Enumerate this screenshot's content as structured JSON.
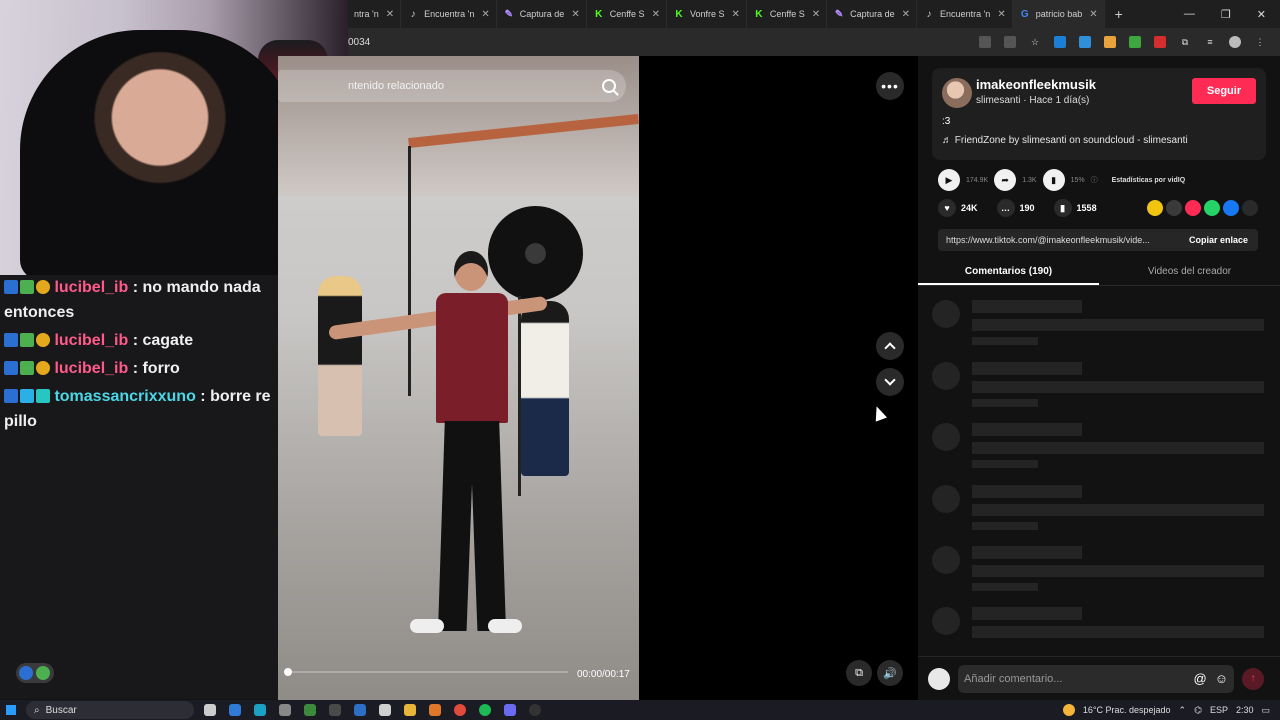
{
  "browser": {
    "tabs": [
      {
        "icon": "tiktok-icon",
        "title": "ntra 'n"
      },
      {
        "icon": "tiktok-icon",
        "title": "Encuentra 'n"
      },
      {
        "icon": "pen-icon",
        "title": "Captura de"
      },
      {
        "icon": "kick-icon",
        "title": "Cenffe S"
      },
      {
        "icon": "kick-icon",
        "title": "Vonfre S"
      },
      {
        "icon": "kick-icon",
        "title": "Cenffe S"
      },
      {
        "icon": "pen-icon",
        "title": "Captura de"
      },
      {
        "icon": "tiktok-icon",
        "title": "Encuentra 'n"
      },
      {
        "icon": "google-icon",
        "title": "patricio bab"
      }
    ],
    "new_tab": "+",
    "url": "0034"
  },
  "chat": {
    "messages": [
      {
        "user": "lucibel_ib",
        "text": ": no mando nada entonces",
        "color": "#ff5a8a"
      },
      {
        "user": "lucibel_ib",
        "text": ": cagate",
        "color": "#ff5a8a"
      },
      {
        "user": "lucibel_ib",
        "text": ": forro",
        "color": "#ff5a8a"
      },
      {
        "user": "tomassancrixxuno",
        "text": ": borre re pillo",
        "color": "#4ad7e6"
      }
    ]
  },
  "video": {
    "search_placeholder": "ntenido relacionado",
    "time": "00:00/00:17",
    "progress": 0.0
  },
  "panel": {
    "username": "imakeonfleekmusik",
    "subline": "slimesanti · Hace 1 día(s)",
    "follow_label": "Seguir",
    "caption": ":3",
    "music": "♬  FriendZone by slimesanti on soundcloud - slimesanti",
    "stats": {
      "plays": "174.9K",
      "shares": "1.3K",
      "rate": "15%",
      "label": "Estadísticas por vidIQ"
    },
    "likes": "24K",
    "comments": "190",
    "saves": "1558",
    "link": "https://www.tiktok.com/@imakeonfleekmusik/vide...",
    "copy_label": "Copiar enlace",
    "tab_comments": "Comentarios (190)",
    "tab_creator": "Videos del creador",
    "comment_placeholder": "Añadir comentario...",
    "brand_color": "#fe2c55"
  },
  "taskbar": {
    "search": "Buscar",
    "weather": "16°C  Prac. despejado",
    "lang": "ESP",
    "time": "2:30"
  }
}
